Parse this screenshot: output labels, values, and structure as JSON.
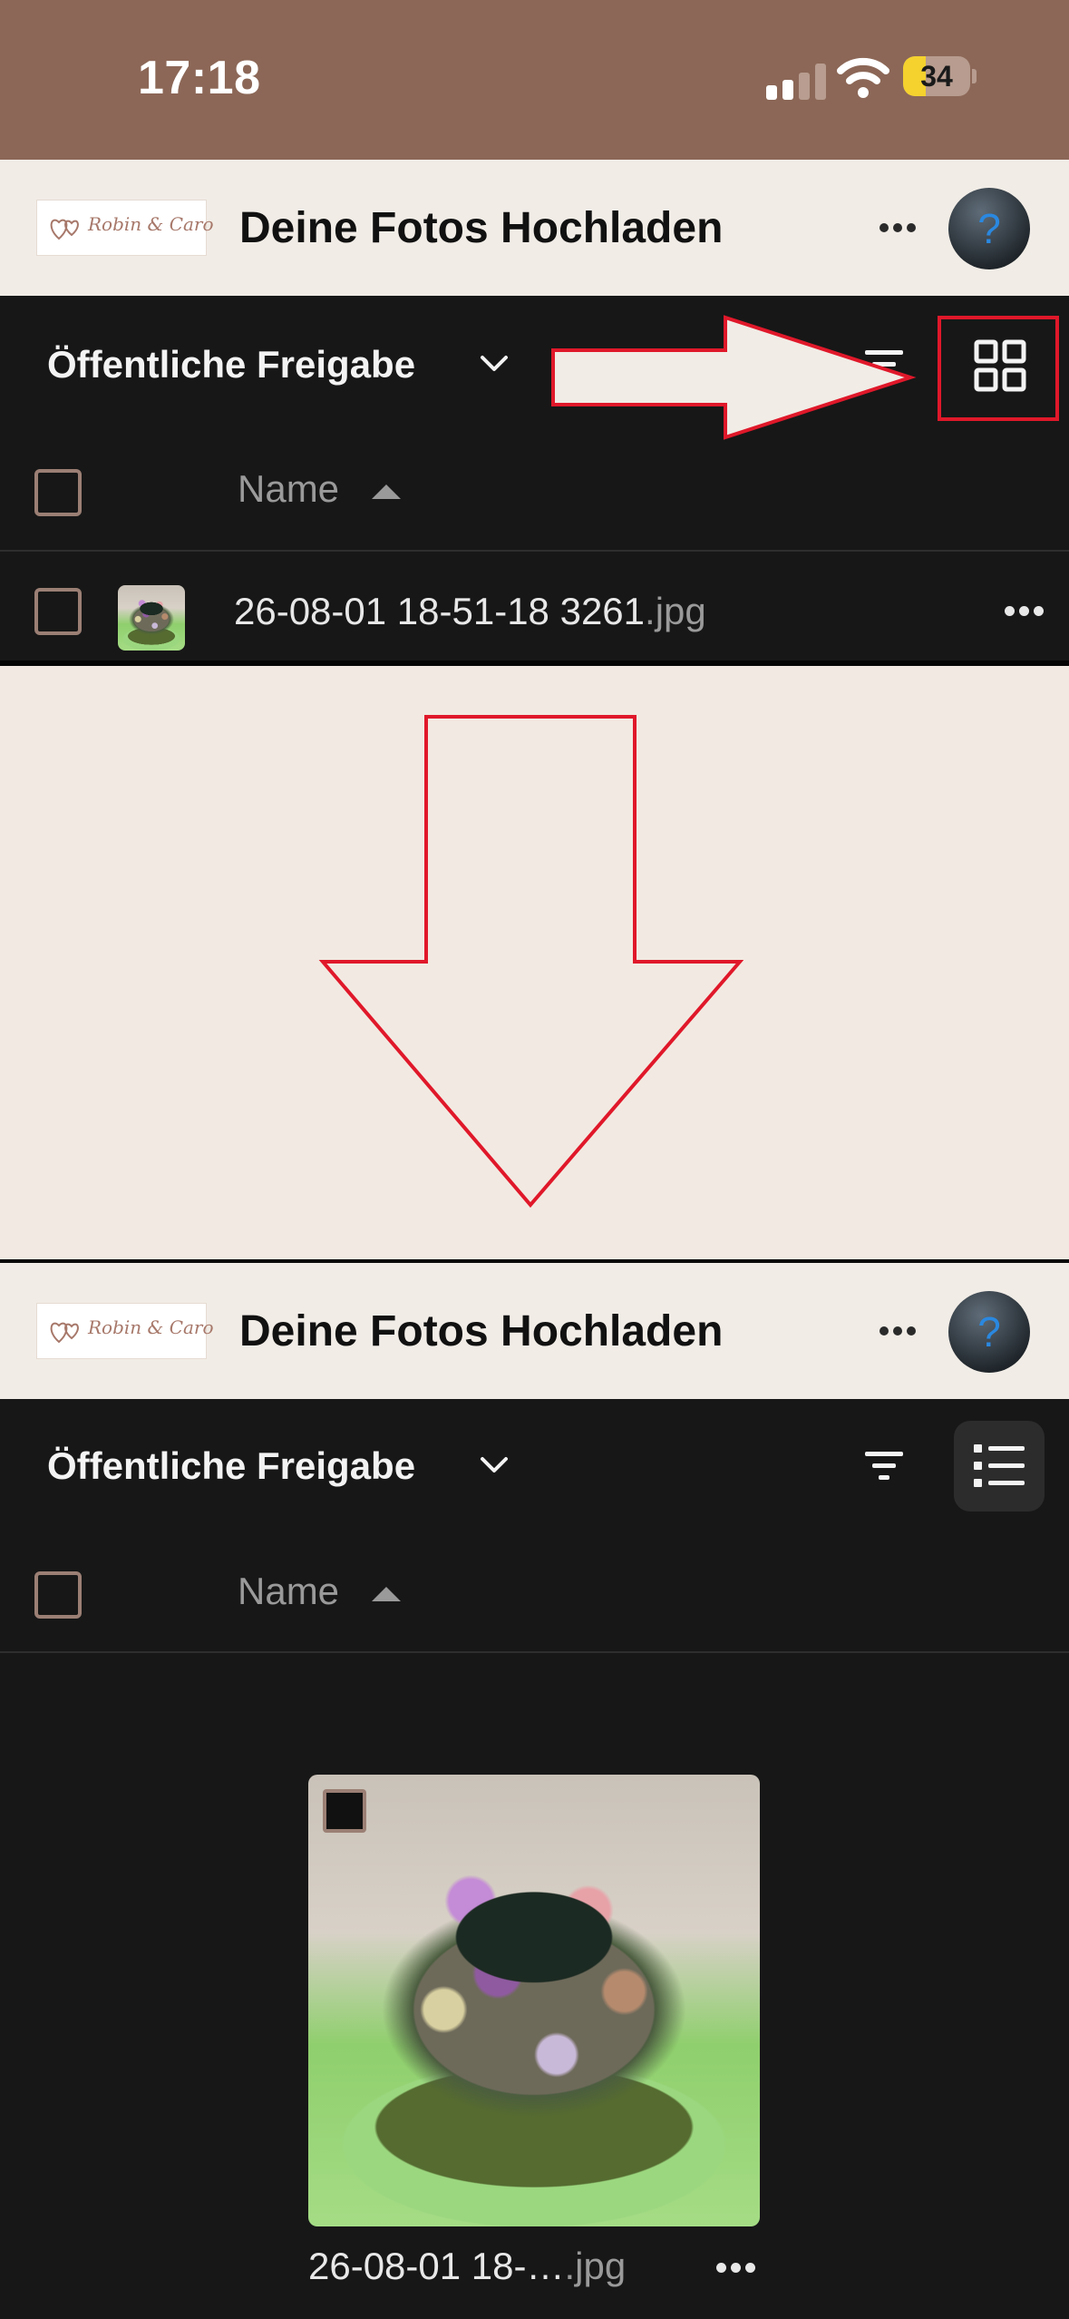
{
  "status_bar": {
    "time": "17:18",
    "battery_level": "34",
    "battery_fraction": 0.34
  },
  "top_screen": {
    "header": {
      "logo_text": "Robin & Caro",
      "title": "Deine Fotos Hochladen",
      "avatar_glyph": "?"
    },
    "toolbar": {
      "share_title": "Öffentliche Freigabe",
      "view_mode_icon": "grid-view-icon"
    },
    "table": {
      "column_name": "Name",
      "rows": [
        {
          "name_base": "26-08-01 18-51-18 3261",
          "extension": ".jpg"
        }
      ]
    }
  },
  "bottom_screen": {
    "header": {
      "logo_text": "Robin & Caro",
      "title": "Deine Fotos Hochladen",
      "avatar_glyph": "?"
    },
    "toolbar": {
      "share_title": "Öffentliche Freigabe",
      "view_mode_icon": "list-view-icon"
    },
    "table": {
      "column_name": "Name"
    },
    "grid": [
      {
        "name_base": "26-08-01 18-…",
        "extension": ".jpg"
      }
    ]
  },
  "colors": {
    "status_bar_bg": "#8c6757",
    "header_bg": "#f1ece6",
    "dark_bg": "#171717",
    "page_bg": "#f2eae2",
    "annotation_red": "#e0182a",
    "checkbox_border": "#9b7f74",
    "battery_yellow": "#f5d22e"
  }
}
